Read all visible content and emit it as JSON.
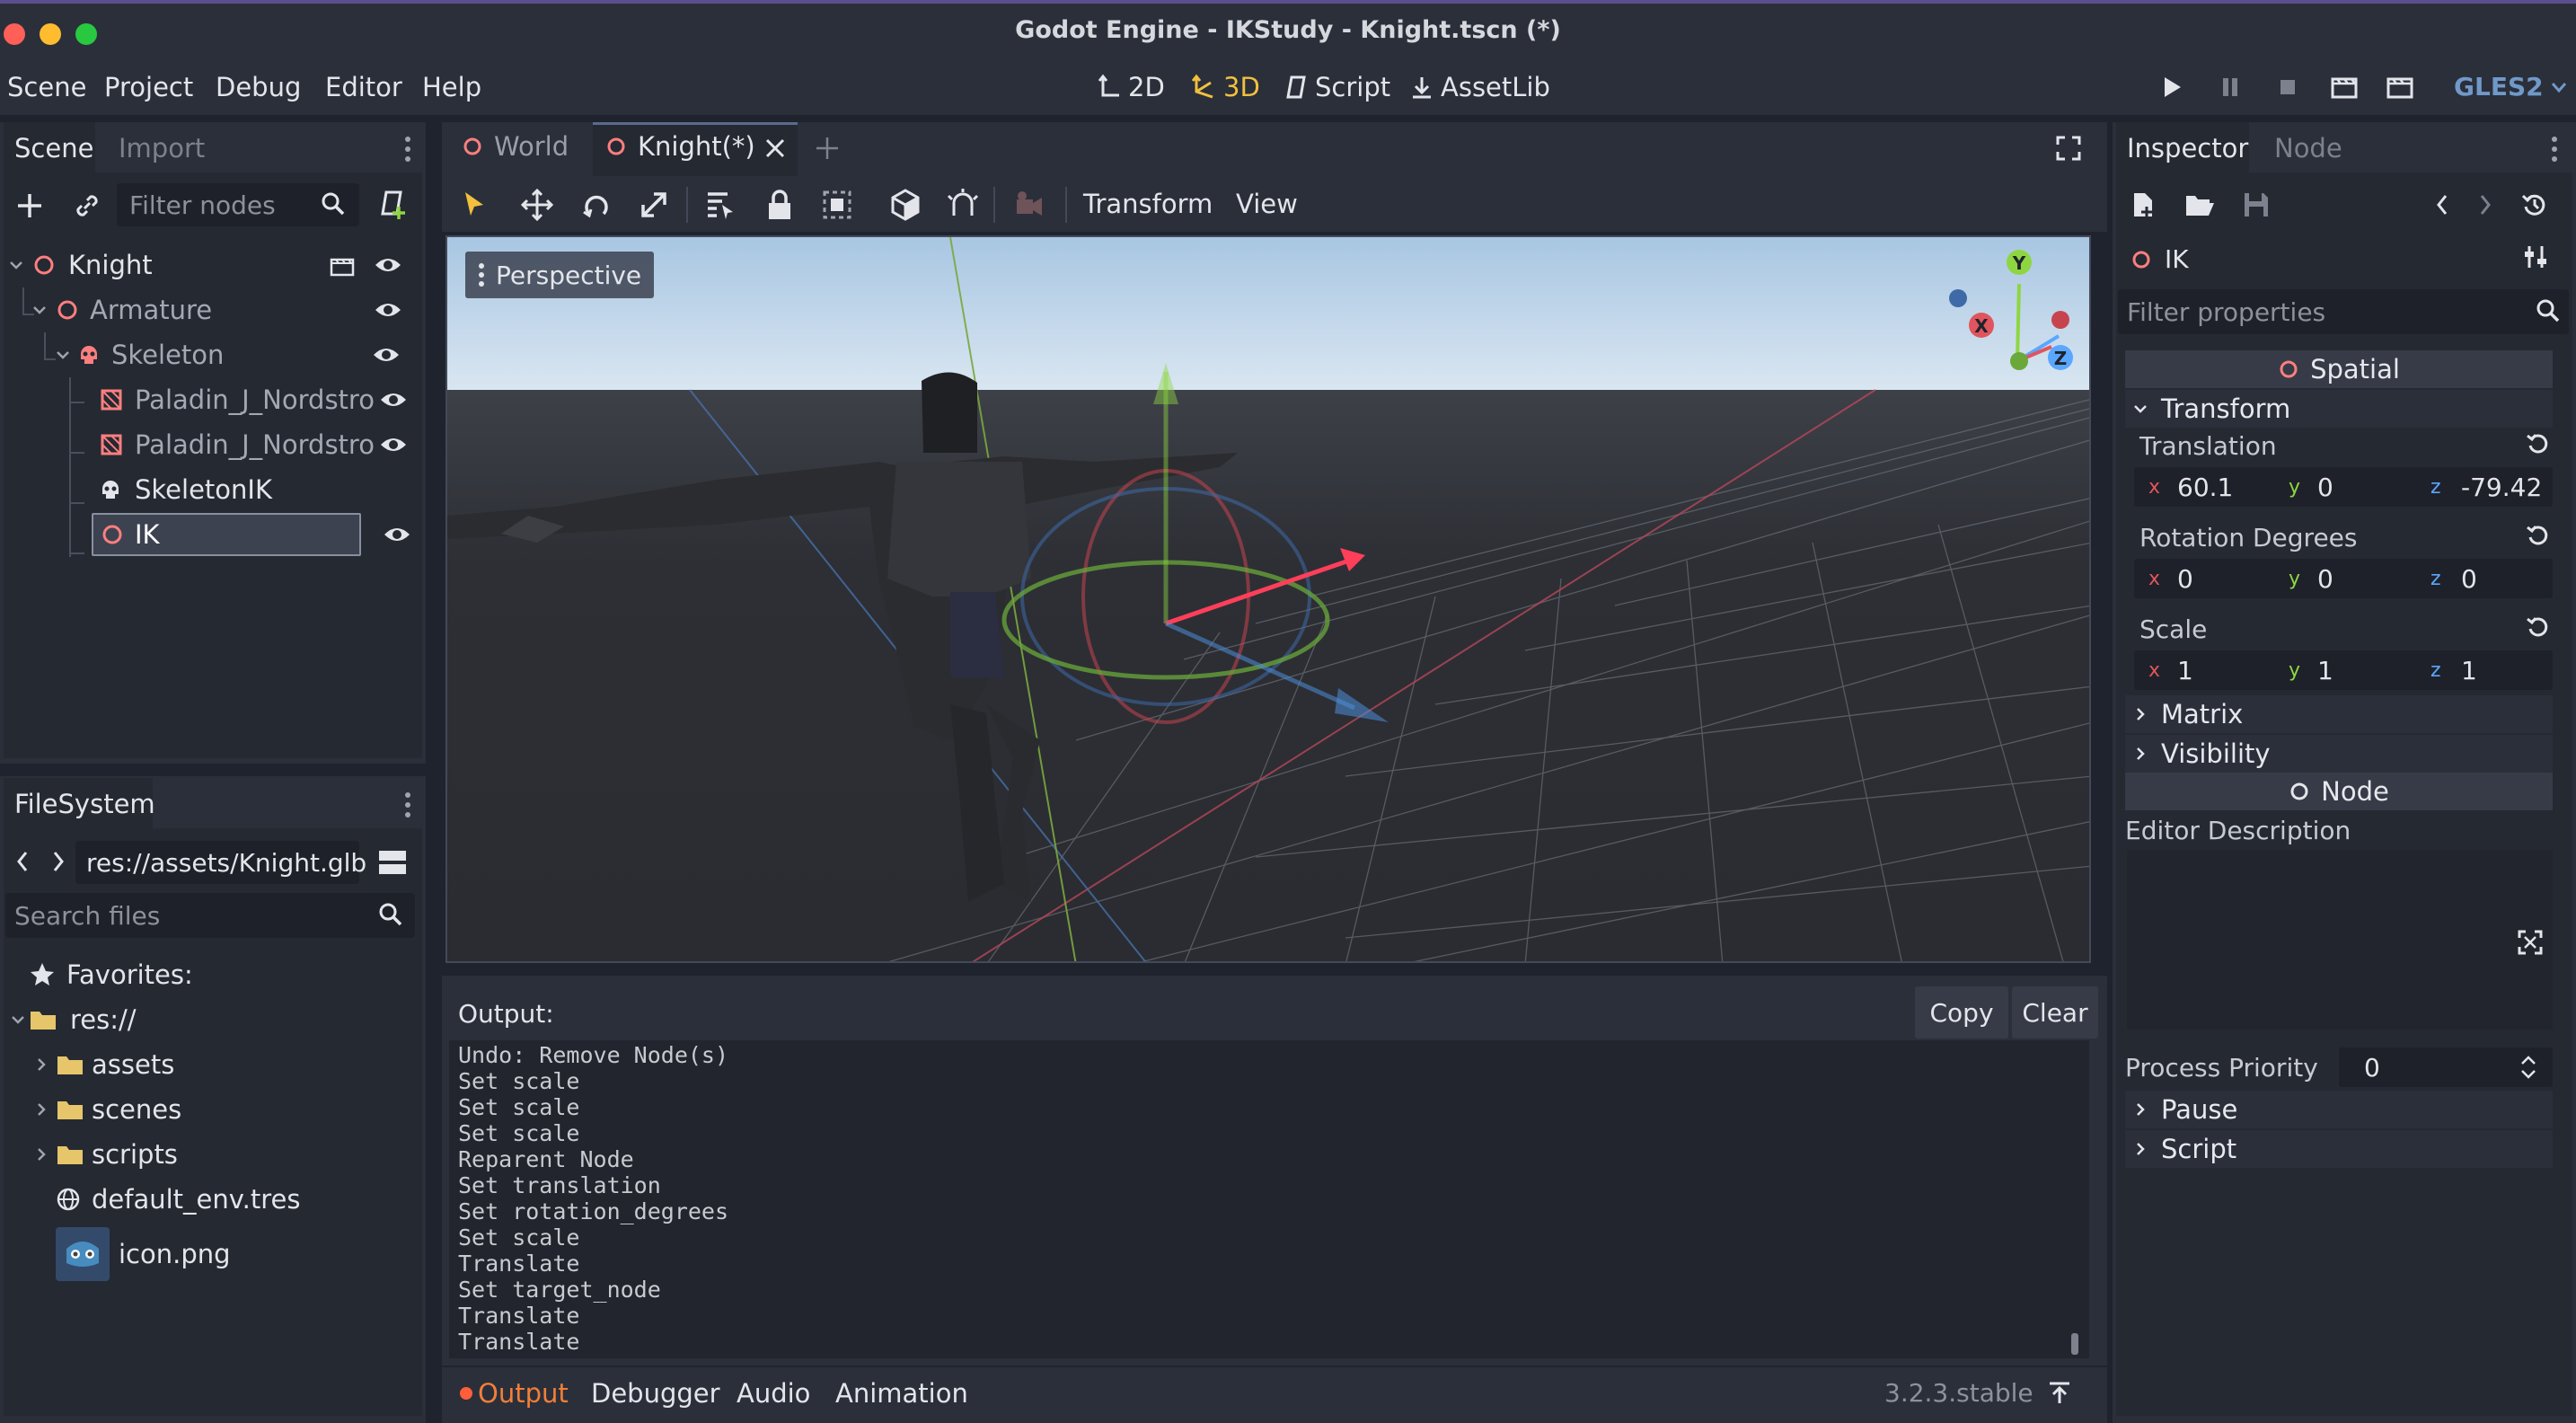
{
  "window": {
    "title": "Godot Engine - IKStudy - Knight.tscn (*)"
  },
  "menu": {
    "items": [
      "Scene",
      "Project",
      "Debug",
      "Editor",
      "Help"
    ]
  },
  "workspaces": {
    "items": [
      "2D",
      "3D",
      "Script",
      "AssetLib"
    ],
    "active": "3D"
  },
  "renderer": "GLES2",
  "scene_dock": {
    "tabs": [
      "Scene",
      "Import"
    ],
    "filter_placeholder": "Filter nodes",
    "tree": [
      {
        "label": "Knight",
        "depth": 0
      },
      {
        "label": "Armature",
        "depth": 1
      },
      {
        "label": "Skeleton",
        "depth": 2
      },
      {
        "label": "Paladin_J_Nordstro",
        "depth": 3
      },
      {
        "label": "Paladin_J_Nordstro",
        "depth": 3
      },
      {
        "label": "SkeletonIK",
        "depth": 3
      },
      {
        "label": "IK",
        "depth": 3
      }
    ]
  },
  "filesystem": {
    "tab": "FileSystem",
    "path": "res://assets/Knight.glb",
    "search_placeholder": "Search files",
    "items": [
      {
        "label": "Favorites:"
      },
      {
        "label": "res://"
      },
      {
        "label": "assets"
      },
      {
        "label": "scenes"
      },
      {
        "label": "scripts"
      },
      {
        "label": "default_env.tres"
      },
      {
        "label": "icon.png"
      }
    ]
  },
  "editor_tabs": {
    "items": [
      "World",
      "Knight(*)"
    ],
    "active": "Knight(*)"
  },
  "viewport_toolbar": {
    "transform_menu": "Transform",
    "view_menu": "View"
  },
  "viewport": {
    "perspective_label": "Perspective",
    "gizmo": {
      "x": "X",
      "y": "Y",
      "z": "Z"
    }
  },
  "output": {
    "title": "Output:",
    "copy_label": "Copy",
    "clear_label": "Clear",
    "lines": [
      "Undo: Remove Node(s)",
      "Set scale",
      "Set scale",
      "Set scale",
      "Reparent Node",
      "Set translation",
      "Set rotation_degrees",
      "Set scale",
      "Translate",
      "Set target_node",
      "Translate",
      "Translate"
    ]
  },
  "bottom_tabs": {
    "items": [
      "Output",
      "Debugger",
      "Audio",
      "Animation"
    ],
    "active": "Output"
  },
  "version": "3.2.3.stable",
  "inspector": {
    "tabs": [
      "Inspector",
      "Node"
    ],
    "node_name": "IK",
    "filter_placeholder": "Filter properties",
    "spatial_label": "Spatial",
    "transform_label": "Transform",
    "translation": {
      "label": "Translation",
      "x": "60.1",
      "y": "0",
      "z": "-79.42"
    },
    "rotation": {
      "label": "Rotation Degrees",
      "x": "0",
      "y": "0",
      "z": "0"
    },
    "scale": {
      "label": "Scale",
      "x": "1",
      "y": "1",
      "z": "1"
    },
    "matrix_label": "Matrix",
    "visibility_label": "Visibility",
    "node_label": "Node",
    "editor_description_label": "Editor Description",
    "process_priority": {
      "label": "Process Priority",
      "value": "0"
    },
    "pause_label": "Pause",
    "script_label": "Script",
    "axis_labels": {
      "x": "x",
      "y": "y",
      "z": "z"
    }
  },
  "colors": {
    "accent": "#f0c03e",
    "output_dot": "#ff5e3a",
    "node_icon": "#fc7f7f",
    "selection": "#3d4250"
  }
}
